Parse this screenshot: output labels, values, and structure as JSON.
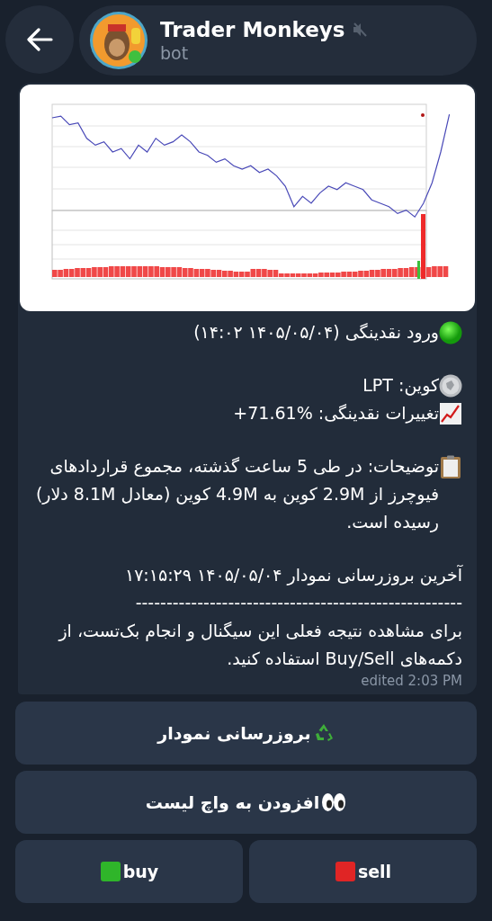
{
  "header": {
    "title": "Trader Monkeys",
    "subtitle": "bot",
    "muted": true
  },
  "message": {
    "image": {
      "kind": "picture"
    },
    "paragraphs": [
      [
        {
          "kind": "signal",
          "text": "ورود نقدینگی (۱۴۰۵/۰۵/۰۴ ۱۴:۰۲)"
        }
      ],
      [
        {
          "kind": "coin",
          "text": "کوین: LPT"
        },
        {
          "kind": "change",
          "text": "تغییرات نقدینگی: %71.61+"
        }
      ],
      [
        {
          "kind": "notes",
          "text": "توضیحات: در طی 5 ساعت گذشته، مجموع قراردادهای فیوچرز از 2.9M کوین به 4.9M کوین (معادل 8.1M دلار) رسیده است."
        }
      ],
      [
        {
          "kind": "text",
          "text": "آخرین بروزرسانی نمودار ۱۴۰۵/۰۵/۰۴ ۱۷:۱۵:۲۹"
        },
        {
          "kind": "text",
          "text": "-----------------------------------------------------"
        },
        {
          "kind": "text",
          "text": "برای مشاهده نتیجه فعلی این سیگنال و انجام بک‌تست، از دکمه‌های Buy/Sell استفاده کنید."
        }
      ]
    ],
    "edited": "edited 2:03 PM"
  },
  "buttons": [
    [
      {
        "kind": "refresh",
        "label": "بروزرسانی نمودار"
      }
    ],
    [
      {
        "kind": "watch",
        "label": "افزودن به واچ لیست"
      }
    ],
    [
      {
        "kind": "sell",
        "label": "sell"
      },
      {
        "kind": "buy",
        "label": "buy"
      }
    ]
  ]
}
